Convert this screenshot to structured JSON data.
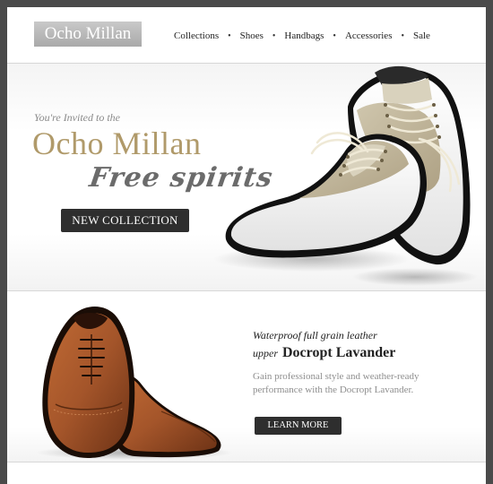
{
  "header": {
    "logo": "Ocho Millan",
    "nav": [
      "Collections",
      "Shoes",
      "Handbags",
      "Accessories",
      "Sale"
    ]
  },
  "hero": {
    "invite": "You're Invited to the",
    "brand": "Ocho Millan",
    "tagline": "Free spirits",
    "button": "NEW COLLECTION"
  },
  "product": {
    "line1": "Waterproof full grain leather",
    "line2_prefix": "upper",
    "name": "Docropt Lavander",
    "description": "Gain professional style and weather-ready performance with the Docropt Lavander.",
    "button": "LEARN MORE"
  },
  "colors": {
    "brand_gold": "#b09a6a",
    "button_dark": "#2e2e2e",
    "leather_brown": "#a4552a"
  }
}
